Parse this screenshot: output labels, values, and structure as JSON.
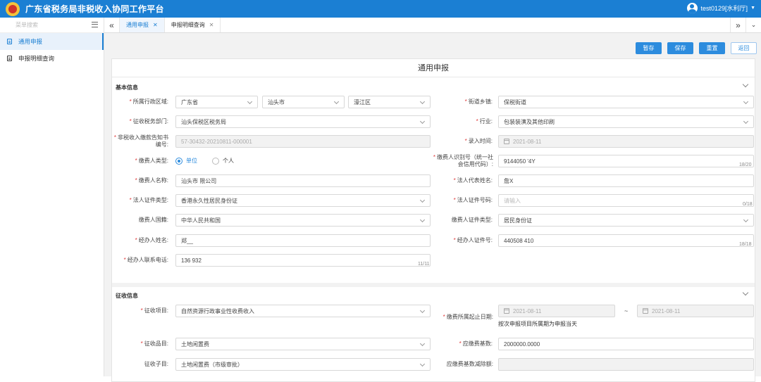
{
  "app": {
    "title": "广东省税务局非税收入协同工作平台",
    "user": "test0129[水利厅]"
  },
  "sidebar": {
    "search_placeholder": "菜单搜索",
    "items": [
      {
        "label": "通用申报",
        "active": true
      },
      {
        "label": "申报明细查询",
        "active": false
      }
    ]
  },
  "tabs": [
    {
      "label": "通用申报",
      "active": true
    },
    {
      "label": "申报明细查询",
      "active": false
    }
  ],
  "toolbar": {
    "temp_save": "暂存",
    "save": "保存",
    "reset": "重置",
    "back": "返回"
  },
  "panel_title": "通用申报",
  "basic": {
    "title": "基本信息",
    "region_label": "所属行政区域:",
    "province": "广东省",
    "city": "汕头市",
    "district": "濠江区",
    "street_label": "街道乡镇:",
    "street": "保税街道",
    "tax_dept_label": "征收税务部门:",
    "tax_dept": "汕头保税区税务局",
    "industry_label": "行业:",
    "industry": "包装装潢及其他印刷",
    "notice_no_label": "非税收入缴款告知书编号:",
    "notice_no": "57-30432-20210811-000001",
    "entry_time_label": "录入时间:",
    "entry_time": "2021-08-11",
    "payer_type_label": "缴费人类型:",
    "payer_type_unit": "单位",
    "payer_type_person": "个人",
    "payer_id_label": "缴费人识别号（统一社会信用代码）:",
    "payer_id": "9144050        '4Y",
    "payer_id_count": "18/20",
    "payer_name_label": "缴费人名称:",
    "payer_name": "汕头市              限公司",
    "legal_rep_label": "法人代表姓名:",
    "legal_rep": "詹X",
    "legal_cert_type_label": "法人证件类型:",
    "legal_cert_type": "香港永久性居民身份证",
    "legal_cert_no_label": "法人证件号码:",
    "legal_cert_no_placeholder": "请输入",
    "legal_cert_no_count": "0/18",
    "nationality_label": "缴费人国籍:",
    "nationality": "中华人民共和国",
    "payer_cert_type_label": "缴费人证件类型:",
    "payer_cert_type": "居民身份证",
    "agent_name_label": "经办人姓名:",
    "agent_name": "郑__",
    "agent_cert_no_label": "经办人证件号:",
    "agent_cert_no": "440508            410",
    "agent_cert_no_count": "18/18",
    "agent_phone_label": "经办人联系电话:",
    "agent_phone": "136        932",
    "agent_phone_count": "11/11"
  },
  "collection": {
    "title": "征收信息",
    "item_label": "征收项目:",
    "item": "自然资源行政事业性收费收入",
    "period_label": "缴费所属起止日期:",
    "period_start": "2021-08-11",
    "period_sep": "~",
    "period_end": "2021-08-11",
    "period_hint": "按次申报项目所属期为申报当天",
    "product_label": "征收品目:",
    "product": "土地闲置费",
    "base_label": "应缴费基数:",
    "base": "2000000.0000",
    "subitem_label": "征收子目:",
    "subitem": "土地闲置费（市级审批）",
    "base_deduct_label": "应缴费基数减除额:",
    "base_deduct": ""
  }
}
